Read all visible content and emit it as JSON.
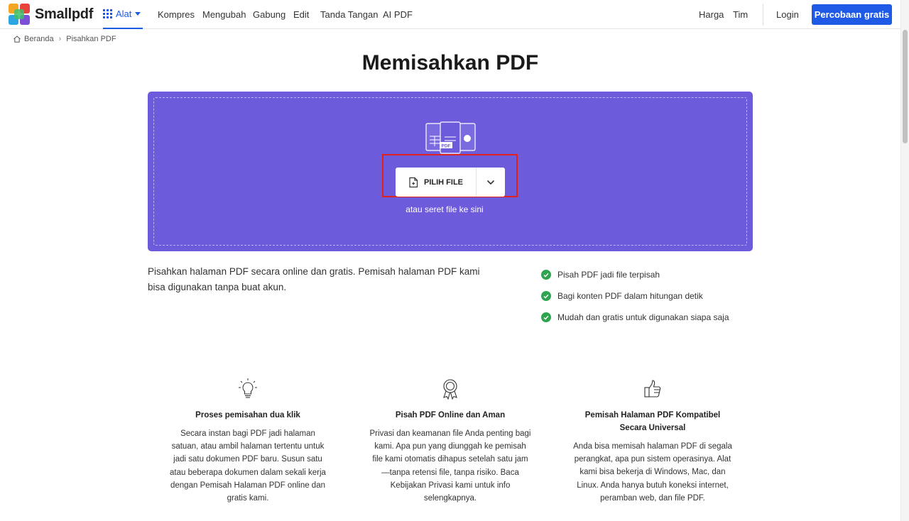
{
  "brand": {
    "name": "Smallpdf",
    "accent": "#1e5ae6",
    "dropzone_color": "#6c5bdb"
  },
  "nav": {
    "tools_label": "Alat",
    "items": [
      "Kompres",
      "Mengubah",
      "Gabung",
      "Edit",
      "Tanda Tangan",
      "AI PDF"
    ],
    "pricing": "Harga",
    "team": "Tim",
    "login": "Login",
    "trial": "Percobaan gratis"
  },
  "breadcrumb": {
    "home": "Beranda",
    "current": "Pisahkan PDF"
  },
  "title": "Memisahkan PDF",
  "dropzone": {
    "choose_label": "PILIH FILE",
    "hint": "atau seret file ke sini",
    "pdf_badge": "PDF"
  },
  "description": "Pisahkan halaman PDF secara online dan gratis. Pemisah halaman PDF kami bisa digunakan tanpa buat akun.",
  "features": [
    "Pisah PDF jadi file terpisah",
    "Bagi konten PDF dalam hitungan detik",
    "Mudah dan gratis untuk digunakan siapa saja"
  ],
  "columns": [
    {
      "icon": "lightbulb-icon",
      "title": "Proses pemisahan dua klik",
      "text": "Secara instan bagi PDF jadi halaman satuan, atau ambil halaman tertentu untuk jadi satu dokumen PDF baru. Susun satu atau beberapa dokumen dalam sekali kerja dengan Pemisah Halaman PDF online dan gratis kami."
    },
    {
      "icon": "award-icon",
      "title": "Pisah PDF Online dan Aman",
      "text": "Privasi dan keamanan file Anda penting bagi kami. Apa pun yang diunggah ke pemisah file kami otomatis dihapus setelah satu jam—tanpa retensi file, tanpa risiko. Baca Kebijakan Privasi kami untuk info selengkapnya."
    },
    {
      "icon": "thumbs-up-icon",
      "title": "Pemisah Halaman PDF Kompatibel Secara Universal",
      "text": "Anda bisa memisah halaman PDF di segala perangkat, apa pun sistem operasinya. Alat kami bisa bekerja di Windows, Mac, dan Linux. Anda hanya butuh koneksi internet, peramban web, dan file PDF."
    }
  ]
}
